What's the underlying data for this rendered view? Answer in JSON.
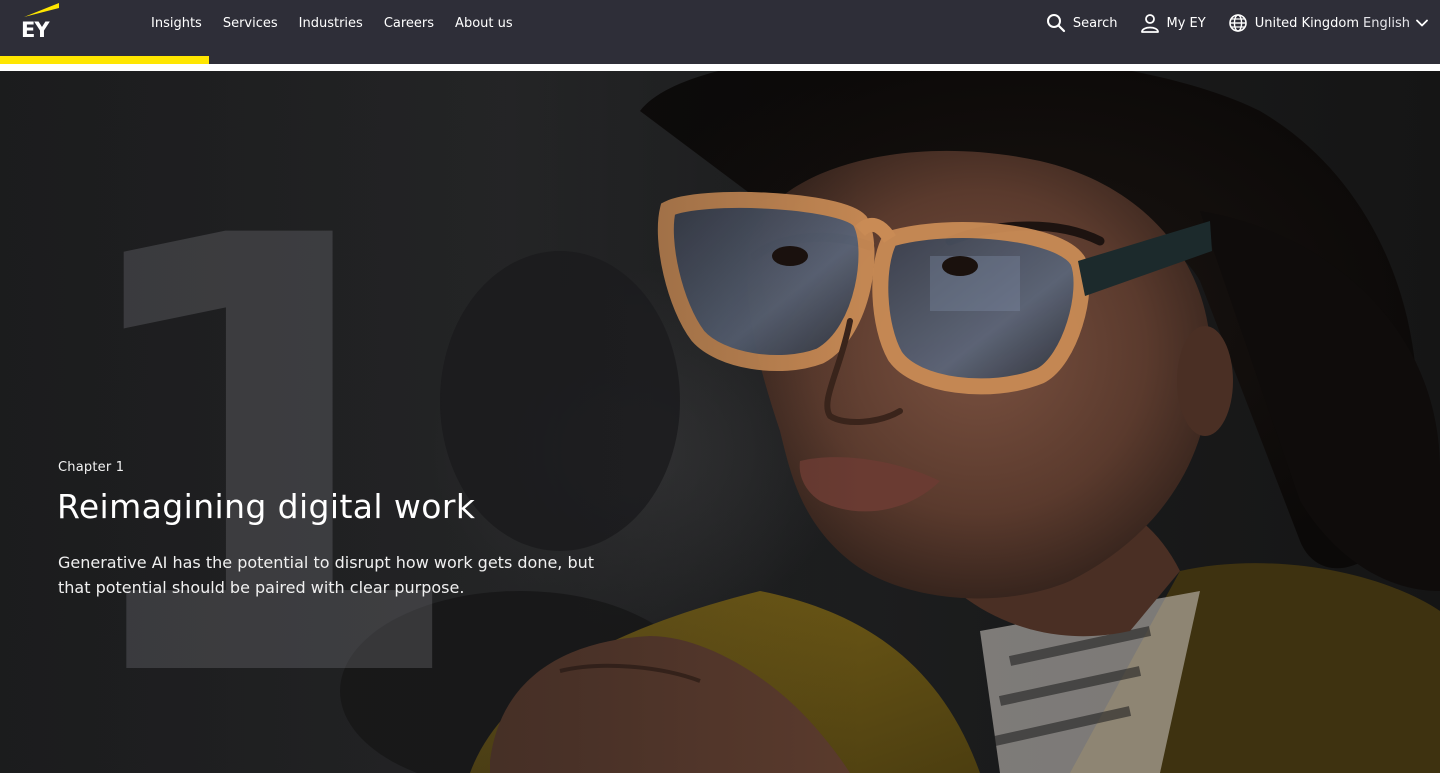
{
  "brand": {
    "logo_text": "EY",
    "accent": "#ffe600",
    "header_bg": "#2e2e38"
  },
  "nav": {
    "items": [
      {
        "label": "Insights"
      },
      {
        "label": "Services"
      },
      {
        "label": "Industries"
      },
      {
        "label": "Careers"
      },
      {
        "label": "About us"
      }
    ]
  },
  "utility": {
    "search_label": "Search",
    "account_label": "My EY",
    "region_label": "United Kingdom",
    "language_label": "English",
    "icons": [
      "search-icon",
      "user-icon",
      "globe-icon",
      "chevron-down-icon"
    ]
  },
  "reading_progress": {
    "percent": 14.5
  },
  "hero": {
    "number": "1",
    "chapter": "Chapter 1",
    "title": "Reimagining digital work",
    "description": "Generative AI has the potential to disrupt how work gets done, but that potential should be paired with clear purpose."
  }
}
